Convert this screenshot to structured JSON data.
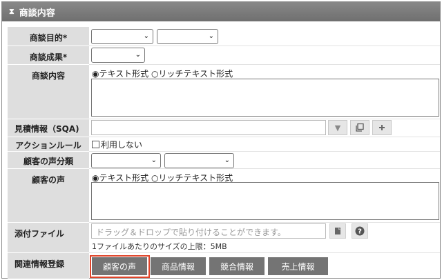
{
  "header": {
    "title": "商談内容"
  },
  "fields": {
    "purpose": {
      "label": "商談目的*"
    },
    "result": {
      "label": "商談成果*"
    },
    "content": {
      "label": "商談内容",
      "opt_text": "テキスト形式",
      "opt_rich": "リッチテキスト形式"
    },
    "estimate": {
      "label": "見積情報（SQA)"
    },
    "action_rule": {
      "label": "アクションルール",
      "checkbox_label": "利用しない",
      "checked": false
    },
    "voice_class": {
      "label": "顧客の声分類"
    },
    "voice": {
      "label": "顧客の声",
      "opt_text": "テキスト形式",
      "opt_rich": "リッチテキスト形式"
    },
    "attachment": {
      "label": "添付ファイル",
      "placeholder": "ドラッグ＆ドロップで貼り付けることができます。",
      "note": "1ファイルあたりのサイズの上限：5MB"
    },
    "related": {
      "label": "関連情報登録"
    }
  },
  "related_buttons": [
    {
      "label": "顧客の声",
      "highlighted": true
    },
    {
      "label": "商品情報"
    },
    {
      "label": "競合情報"
    },
    {
      "label": "売上情報"
    }
  ],
  "colors": {
    "header_bg": "#777777",
    "label_bg": "#dedede",
    "button_bg": "#747474",
    "highlight": "#e0442a"
  },
  "icons": {
    "header": "hourglass-icon",
    "dropdown": "chevron-down-icon",
    "copy": "copy-icon",
    "add": "plus-icon",
    "file": "file-icon",
    "help": "help-icon"
  }
}
